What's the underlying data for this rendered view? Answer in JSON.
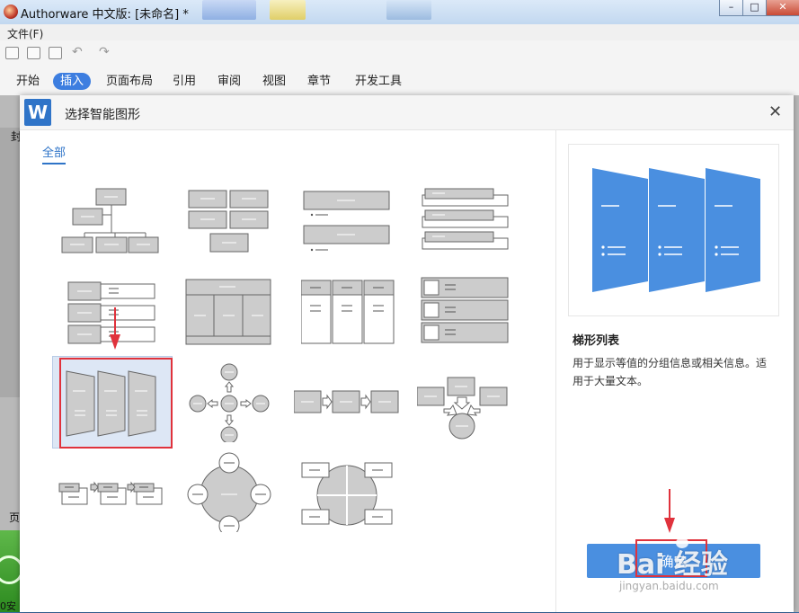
{
  "window": {
    "title": "Authorware 中文版: [未命名] *",
    "menu_file": "文件(F)"
  },
  "window_buttons": {
    "minimize": "–",
    "maximize": "□",
    "close": "✕"
  },
  "ribbon": {
    "tabs": [
      "开始",
      "插入",
      "页面布局",
      "引用",
      "审阅",
      "视图",
      "章节",
      "开发工具"
    ],
    "active_tab": "插入"
  },
  "left_edge": {
    "char1": "封",
    "char2": "页",
    "char3": "0安"
  },
  "dialog": {
    "title": "选择智能图形",
    "close_glyph": "✕",
    "category_tab": "全部",
    "selected_name": "梯形列表",
    "selected_desc": "用于显示等值的分组信息或相关信息。适用于大量文本。",
    "ok_label": "确定"
  },
  "watermark": {
    "brand": "Bai 经验",
    "url": "jingyan.baidu.com"
  },
  "colors": {
    "accent": "#2f74c8",
    "preview_fill": "#4a8fe0",
    "highlight": "#e0323c",
    "thumb_fill": "#cccccc"
  },
  "thumbnails": [
    {
      "name": "organization-chart"
    },
    {
      "name": "block-grid"
    },
    {
      "name": "stacked-list"
    },
    {
      "name": "bracket-list"
    },
    {
      "name": "labeled-rows"
    },
    {
      "name": "table-columns"
    },
    {
      "name": "column-cards"
    },
    {
      "name": "picture-rows"
    },
    {
      "name": "trapezoid-list",
      "selected": true
    },
    {
      "name": "radial-arrows"
    },
    {
      "name": "process-arrows"
    },
    {
      "name": "converging-arrows"
    },
    {
      "name": "step-process"
    },
    {
      "name": "circle-cycle"
    },
    {
      "name": "segmented-circle"
    }
  ]
}
